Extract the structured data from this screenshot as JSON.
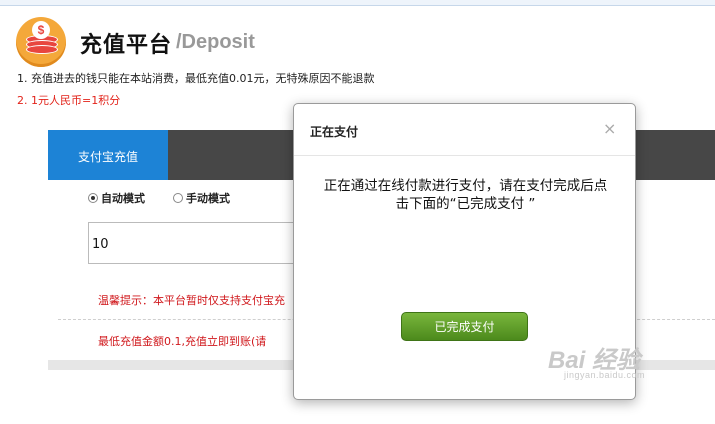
{
  "header": {
    "title": "充值平台",
    "subtitle": "/Deposit"
  },
  "notes": {
    "line1": "1. 充值进去的钱只能在本站消费，最低充值0.01元，无特殊原因不能退款",
    "line2": "2. 1元人民币=1积分"
  },
  "panel": {
    "tab_active": "支付宝充值",
    "mode_auto": "自动模式",
    "mode_manual": "手动模式",
    "selected_mode": "自动模式",
    "amount_value": "10",
    "tip1": "温馨提示：本平台暂时仅支持支付宝充",
    "tip2": "最低充值金额0.1,充值立即到账(请"
  },
  "modal": {
    "title": "正在支付",
    "close": "×",
    "message": "正在通过在线付款进行支付，请在支付完成后点击下面的“已完成支付 ”",
    "button": "已完成支付"
  },
  "watermark": {
    "main": "Bai 经验",
    "sub": "jingyan.baidu.com"
  },
  "colors": {
    "tab_active": "#1d83d6",
    "tab_bar": "#474747",
    "tip_red": "#d0181c",
    "button_green": "#5b9b27"
  }
}
